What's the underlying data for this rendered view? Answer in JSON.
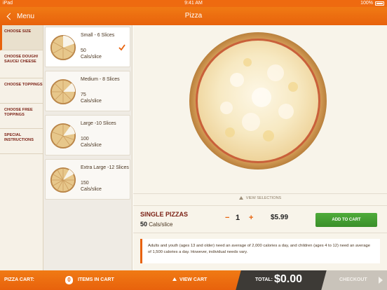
{
  "status_bar": {
    "carrier": "iPad",
    "time": "9:41 AM",
    "battery": "100%"
  },
  "nav": {
    "back_label": "Menu",
    "title": "Pizza"
  },
  "steps": [
    {
      "label": "CHOOSE SIZE",
      "active": true
    },
    {
      "label": "CHOOSE DOUGH/ SAUCE/ CHEESE",
      "active": false
    },
    {
      "label": "CHOOSE TOPPINGS",
      "active": false
    },
    {
      "label": "CHOOSE FREE TOPPINGS",
      "active": false
    },
    {
      "label": "SPECIAL INSTRUCTIONS",
      "active": false
    }
  ],
  "sizes": [
    {
      "label": "Small - 6 Slices",
      "cal_value": "50",
      "cal_unit": "Cals/slice",
      "selected": true
    },
    {
      "label": "Medium - 8 Slices",
      "cal_value": "75",
      "cal_unit": "Cals/slice",
      "selected": false
    },
    {
      "label": "Large -10 Slices",
      "cal_value": "100",
      "cal_unit": "Cals/slice",
      "selected": false
    },
    {
      "label": "Extra Large -12 Slices",
      "cal_value": "150",
      "cal_unit": "Cals/slice",
      "selected": false
    }
  ],
  "view_selections_label": "VIEW SELECTIONS",
  "order": {
    "title": "SINGLE PIZZAS",
    "cal_value": "50",
    "cal_unit": "Cals/slice",
    "minus": "−",
    "quantity": "1",
    "plus": "+",
    "price": "$5.99",
    "add_to_cart_label": "ADD TO CART"
  },
  "notice": "Adults and youth (ages 13 and older) need an average of 2,000 calories a day, and children (ages 4 to 12) need an average of 1,500 calories a day. However, individual needs vary.",
  "cart": {
    "label": "PIZZA CART:",
    "count": "0",
    "items_label": "ITEMS IN CART",
    "view_cart_label": "VIEW CART",
    "total_label": "TOTAL:",
    "total_value": "$0.00",
    "checkout_label": "CHECKOUT"
  },
  "colors": {
    "accent": "#e8620c",
    "step_text": "#7a1f13",
    "add_button": "#3b8f2a",
    "total_bg": "#3d3a36"
  }
}
